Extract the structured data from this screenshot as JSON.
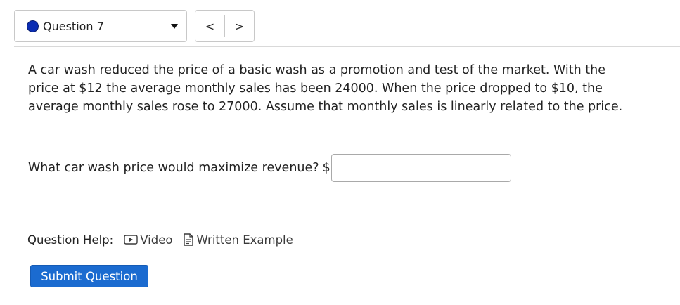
{
  "question_nav": {
    "current_label": "Question 7",
    "status_color": "#0b2db3",
    "prev_glyph": "<",
    "next_glyph": ">"
  },
  "problem": {
    "text": "A car wash reduced the price of a basic wash as a promotion and test of the market. With the price at $12 the average monthly sales has been 24000. When the price dropped to $10, the average monthly sales rose to 27000. Assume that monthly sales is linearly related to the price."
  },
  "answer": {
    "prompt": "What car wash price would maximize revenue?",
    "prefix": "$",
    "value": "",
    "placeholder": ""
  },
  "help": {
    "label": "Question Help:",
    "video_label": "Video",
    "written_example_label": "Written Example",
    "video_icon": "video-icon",
    "written_example_icon": "document-icon"
  },
  "submit": {
    "label": "Submit Question",
    "color": "#1b6bd0"
  }
}
